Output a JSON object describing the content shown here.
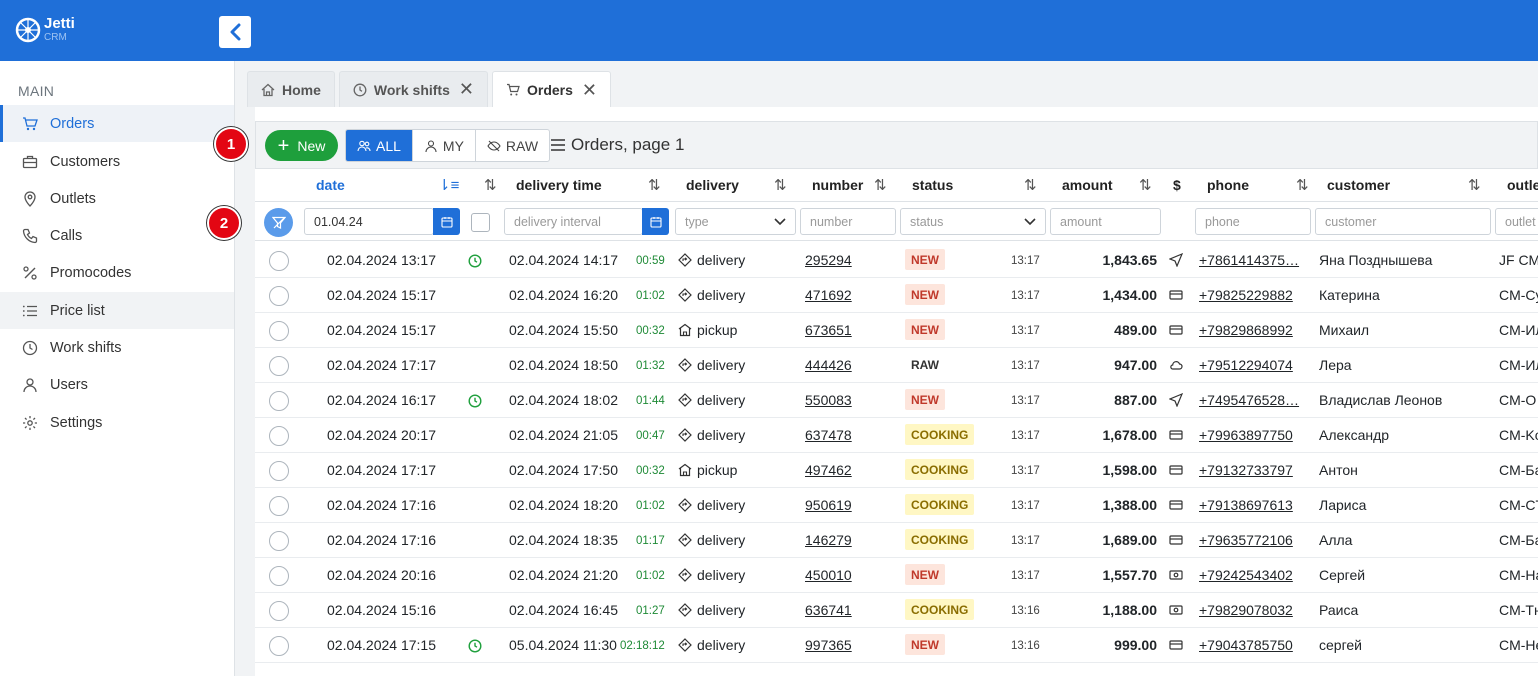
{
  "app": {
    "name": "Jetti",
    "sub": "CRM"
  },
  "sidebar": {
    "section": "MAIN",
    "items": [
      {
        "label": "Orders",
        "icon": "cart-icon"
      },
      {
        "label": "Customers",
        "icon": "briefcase-icon"
      },
      {
        "label": "Outlets",
        "icon": "map-pin-icon"
      },
      {
        "label": "Calls",
        "icon": "phone-icon"
      },
      {
        "label": "Promocodes",
        "icon": "percent-icon"
      },
      {
        "label": "Price list",
        "icon": "list-icon"
      },
      {
        "label": "Work shifts",
        "icon": "clock-icon"
      },
      {
        "label": "Users",
        "icon": "user-icon"
      },
      {
        "label": "Settings",
        "icon": "gear-icon"
      }
    ]
  },
  "tabs": [
    {
      "label": "Home"
    },
    {
      "label": "Work shifts"
    },
    {
      "label": "Orders"
    }
  ],
  "toolbar": {
    "new_label": "New",
    "filters": [
      "ALL",
      "MY",
      "RAW"
    ],
    "title": "Orders, page 1"
  },
  "annotations": [
    "1",
    "2"
  ],
  "columns": {
    "date": "date",
    "delivery_time": "delivery time",
    "delivery": "delivery",
    "number": "number",
    "status": "status",
    "amount": "amount",
    "pay": "$",
    "phone": "phone",
    "customer": "customer",
    "outlet": "outle"
  },
  "filters": {
    "date_value": "01.04.24",
    "delivery_interval_placeholder": "delivery interval",
    "type_placeholder": "type",
    "number_placeholder": "number",
    "status_placeholder": "status",
    "amount_placeholder": "amount",
    "phone_placeholder": "phone",
    "customer_placeholder": "customer",
    "outlet_placeholder": "outlet"
  },
  "rows": [
    {
      "date": "02.04.2024 13:17",
      "clock": true,
      "dtime": "02.04.2024 14:17",
      "dur": "00:59",
      "type": "delivery",
      "number": "295294",
      "status": "NEW",
      "stime": "13:17",
      "amount": "1,843.65",
      "pay": "send",
      "phone": "+7861414375…",
      "customer": "Яна Позднышева",
      "outlet": "JF CM"
    },
    {
      "date": "02.04.2024 15:17",
      "clock": false,
      "dtime": "02.04.2024 16:20",
      "dur": "01:02",
      "type": "delivery",
      "number": "471692",
      "status": "NEW",
      "stime": "13:17",
      "amount": "1,434.00",
      "pay": "card",
      "phone": "+79825229882",
      "customer": "Катерина",
      "outlet": "CM-Cy"
    },
    {
      "date": "02.04.2024 15:17",
      "clock": false,
      "dtime": "02.04.2024 15:50",
      "dur": "00:32",
      "type": "pickup",
      "number": "673651",
      "status": "NEW",
      "stime": "13:17",
      "amount": "489.00",
      "pay": "card",
      "phone": "+79829868992",
      "customer": "Михаил",
      "outlet": "CM-Ил"
    },
    {
      "date": "02.04.2024 17:17",
      "clock": false,
      "dtime": "02.04.2024 18:50",
      "dur": "01:32",
      "type": "delivery",
      "number": "444426",
      "status": "RAW",
      "stime": "13:17",
      "amount": "947.00",
      "pay": "cloud",
      "phone": "+79512294074",
      "customer": "Лера",
      "outlet": "CM-Ил"
    },
    {
      "date": "02.04.2024 16:17",
      "clock": true,
      "dtime": "02.04.2024 18:02",
      "dur": "01:44",
      "type": "delivery",
      "number": "550083",
      "status": "NEW",
      "stime": "13:17",
      "amount": "887.00",
      "pay": "send",
      "phone": "+7495476528…",
      "customer": "Владислав Леонов",
      "outlet": "CM-O"
    },
    {
      "date": "02.04.2024 20:17",
      "clock": false,
      "dtime": "02.04.2024 21:05",
      "dur": "00:47",
      "type": "delivery",
      "number": "637478",
      "status": "COOKING",
      "stime": "13:17",
      "amount": "1,678.00",
      "pay": "card",
      "phone": "+79963897750",
      "customer": "Александр",
      "outlet": "CM-Ko"
    },
    {
      "date": "02.04.2024 17:17",
      "clock": false,
      "dtime": "02.04.2024 17:50",
      "dur": "00:32",
      "type": "pickup",
      "number": "497462",
      "status": "COOKING",
      "stime": "13:17",
      "amount": "1,598.00",
      "pay": "card",
      "phone": "+79132733797",
      "customer": "Антон",
      "outlet": "CM-Ба"
    },
    {
      "date": "02.04.2024 17:16",
      "clock": false,
      "dtime": "02.04.2024 18:20",
      "dur": "01:02",
      "type": "delivery",
      "number": "950619",
      "status": "COOKING",
      "stime": "13:17",
      "amount": "1,388.00",
      "pay": "card",
      "phone": "+79138697613",
      "customer": "Лариса",
      "outlet": "CM-CT"
    },
    {
      "date": "02.04.2024 17:16",
      "clock": false,
      "dtime": "02.04.2024 18:35",
      "dur": "01:17",
      "type": "delivery",
      "number": "146279",
      "status": "COOKING",
      "stime": "13:17",
      "amount": "1,689.00",
      "pay": "card",
      "phone": "+79635772106",
      "customer": "Алла",
      "outlet": "CM-Ба"
    },
    {
      "date": "02.04.2024 20:16",
      "clock": false,
      "dtime": "02.04.2024 21:20",
      "dur": "01:02",
      "type": "delivery",
      "number": "450010",
      "status": "NEW",
      "stime": "13:17",
      "amount": "1,557.70",
      "pay": "cash",
      "phone": "+79242543402",
      "customer": "Сергей",
      "outlet": "CM-На"
    },
    {
      "date": "02.04.2024 15:16",
      "clock": false,
      "dtime": "02.04.2024 16:45",
      "dur": "01:27",
      "type": "delivery",
      "number": "636741",
      "status": "COOKING",
      "stime": "13:16",
      "amount": "1,188.00",
      "pay": "cash",
      "phone": "+79829078032",
      "customer": "Раиса",
      "outlet": "CM-Тн"
    },
    {
      "date": "02.04.2024 17:15",
      "clock": true,
      "dtime": "05.04.2024 11:30",
      "dur": "02:18:12",
      "type": "delivery",
      "number": "997365",
      "status": "NEW",
      "stime": "13:16",
      "amount": "999.00",
      "pay": "card",
      "phone": "+79043785750",
      "customer": "сергей",
      "outlet": "CM-Не"
    }
  ]
}
